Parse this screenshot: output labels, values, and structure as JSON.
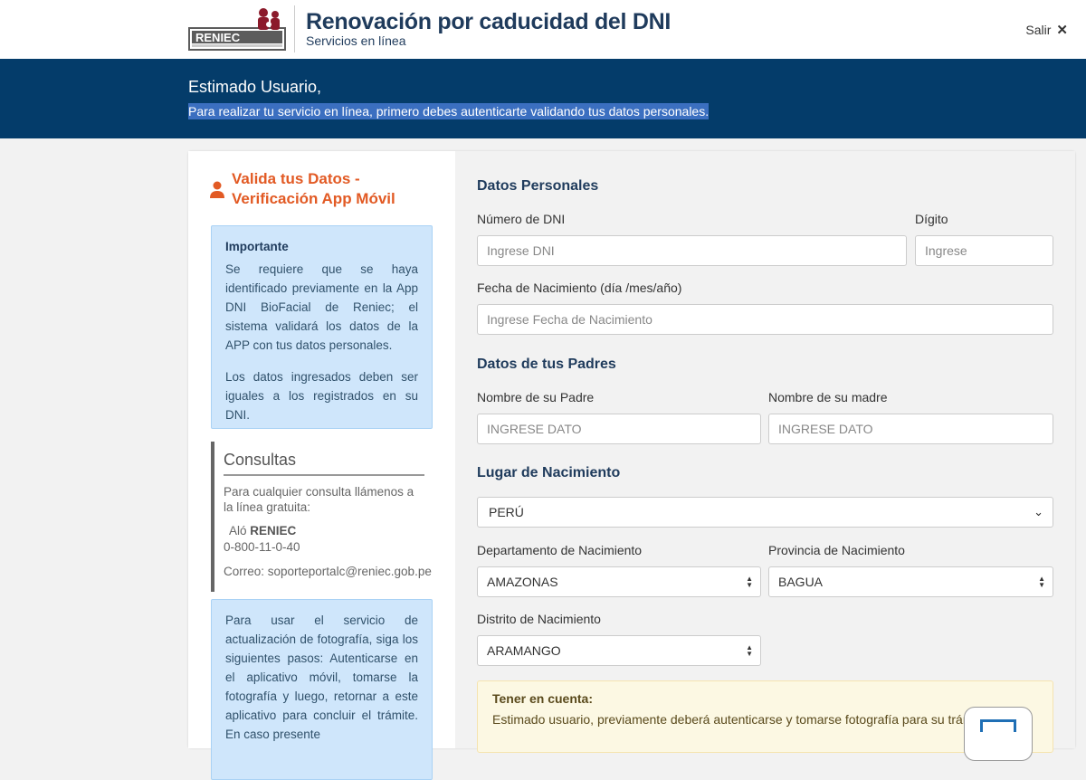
{
  "header": {
    "logo_text": "RENIEC",
    "title": "Renovación por caducidad del DNI",
    "subtitle": "Servicios en línea",
    "logout_label": "Salir",
    "logout_icon": "close-icon"
  },
  "banner": {
    "greeting": "Estimado Usuario,",
    "message": "Para realizar tu servicio en línea, primero debes autenticarte validando tus datos personales."
  },
  "sidebar": {
    "title": "Valida tus Datos - Verificación App Móvil",
    "important": {
      "title": "Importante",
      "p1": "Se requiere que se haya identificado previamente en la App DNI BioFacial de Reniec; el sistema validará los datos de la APP con tus datos personales.",
      "p2": "Los datos ingresados deben ser iguales a los registrados en su DNI."
    },
    "consultas": {
      "title": "Consultas",
      "text": "Para cualquier consulta llámenos a la línea gratuita:",
      "alo_prefix": "Aló",
      "alo_brand": "RENIEC",
      "phone": "0-800-11-0-40",
      "email": "Correo: soporteportalc@reniec.gob.pe"
    },
    "steps_text": "Para usar el servicio de actualización de fotografía, siga los siguientes pasos: Autenticarse en el aplicativo móvil, tomarse la fotografía y luego, retornar a este aplicativo para concluir el trámite. En caso presente"
  },
  "form": {
    "personal": {
      "title": "Datos Personales",
      "dni_label": "Número de DNI",
      "dni_placeholder": "Ingrese DNI",
      "digit_label": "Dígito",
      "digit_placeholder": "Ingrese",
      "birth_label": "Fecha de Nacimiento (día /mes/año)",
      "birth_placeholder": "Ingrese Fecha de Nacimiento"
    },
    "parents": {
      "title": "Datos de tus Padres",
      "father_label": "Nombre de su Padre",
      "father_placeholder": "INGRESE DATO",
      "mother_label": "Nombre de su madre",
      "mother_placeholder": "INGRESE DATO"
    },
    "birthplace": {
      "title": "Lugar de Nacimiento",
      "country": "PERÚ",
      "department_label": "Departamento de Nacimiento",
      "department": "AMAZONAS",
      "province_label": "Provincia de Nacimiento",
      "province": "BAGUA",
      "district_label": "Distrito de Nacimiento",
      "district": "ARAMANGO"
    },
    "notice": {
      "title": "Tener en cuenta:",
      "text": "Estimado usuario, previamente deberá autenticarse y tomarse fotografía para su trámite a"
    }
  },
  "colors": {
    "brand_navy": "#043c6a",
    "title_blue": "#1f3b5c",
    "accent_orange": "#e25a24",
    "info_bg": "#cfe6fb",
    "notice_bg": "#fcf8e3"
  }
}
